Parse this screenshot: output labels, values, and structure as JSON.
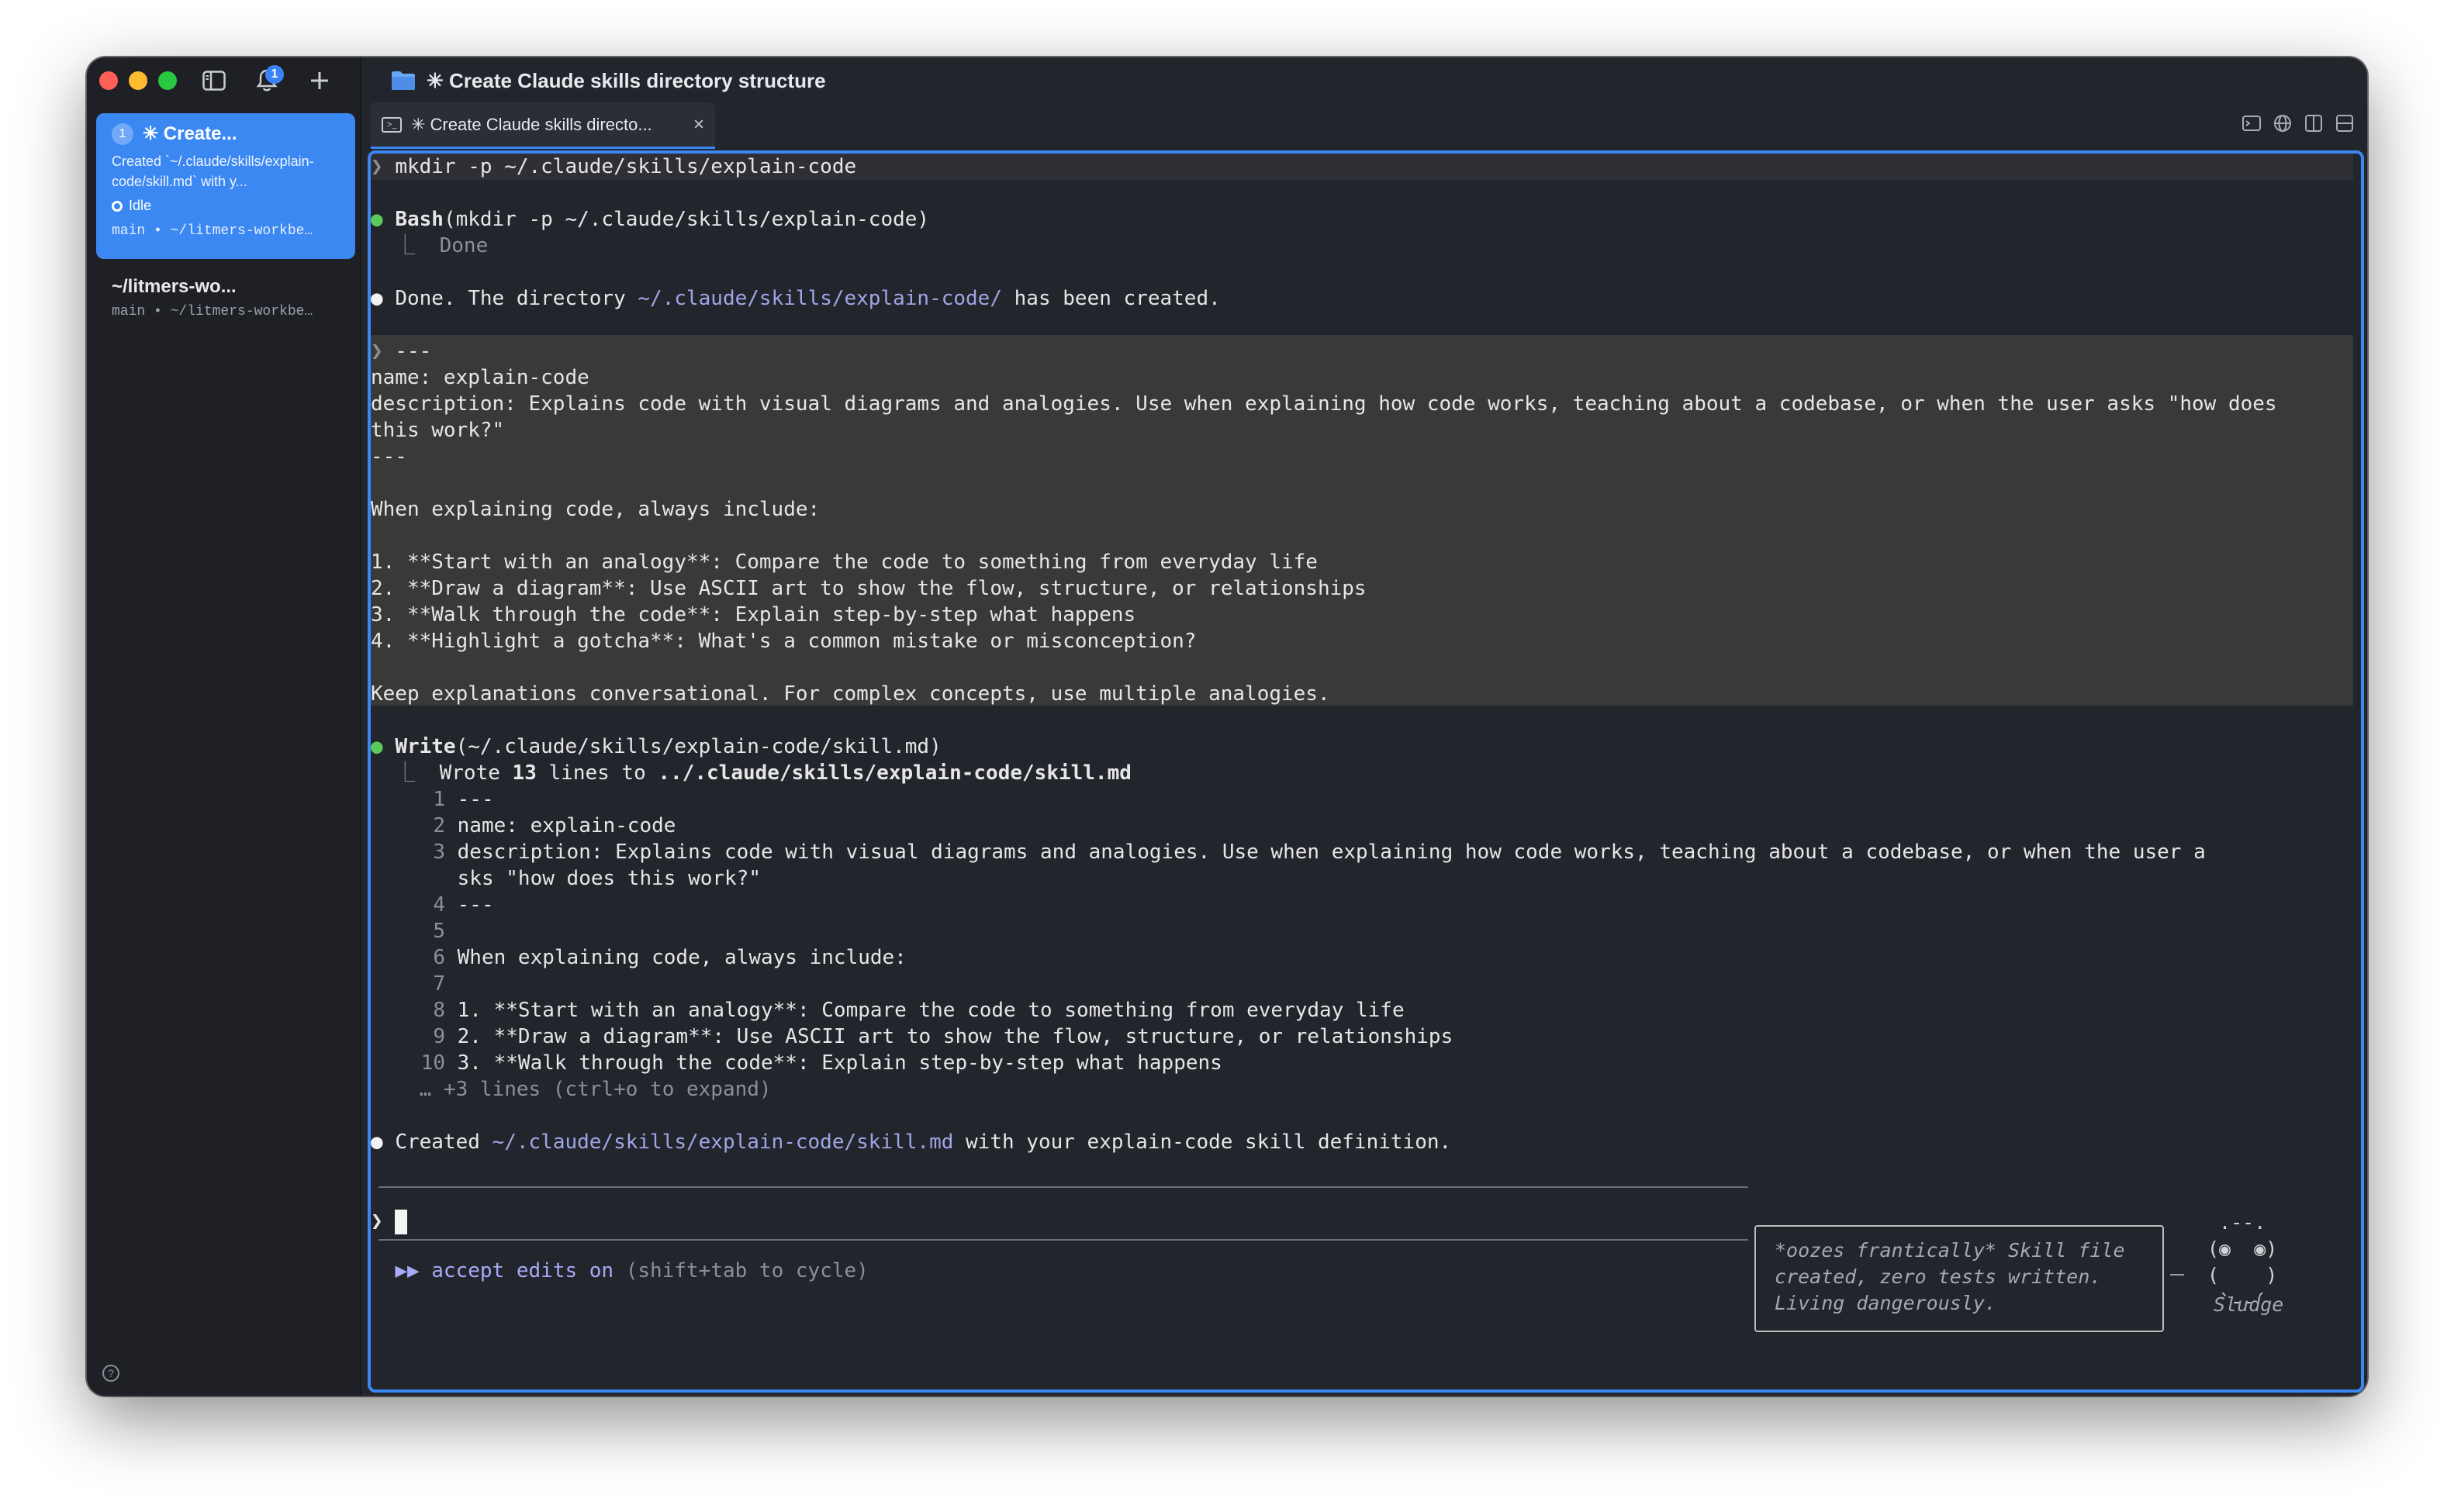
{
  "titlebar": {
    "title": "✳ Create Claude skills directory structure",
    "notification_count": "1"
  },
  "sidebar": {
    "active_session": {
      "number": "1",
      "title": "✳ Create...",
      "description": "Created `~/.claude/skills/explain-code/skill.md` with y...",
      "status": "Idle",
      "branch": "main • ~/litmers-workbe…"
    },
    "other_session": {
      "title": "~/litmers-wo...",
      "branch": "main • ~/litmers-workbe…"
    }
  },
  "tab": {
    "label": "✳ Create Claude skills directo..."
  },
  "terminal": {
    "prompt_cmd": "mkdir -p ~/.claude/skills/explain-code",
    "bash_call_name": "Bash",
    "bash_call_args": "(mkdir -p ~/.claude/skills/explain-code)",
    "bash_result": "Done",
    "done_prefix": "Done. The directory ",
    "done_path": "~/.claude/skills/explain-code/",
    "done_suffix": " has been created.",
    "user_block": [
      "---",
      "name: explain-code",
      "description: Explains code with visual diagrams and analogies. Use when explaining how code works, teaching about a codebase, or when the user asks \"how does",
      "this work?\"",
      "---",
      "",
      "When explaining code, always include:",
      "",
      "1. **Start with an analogy**: Compare the code to something from everyday life",
      "2. **Draw a diagram**: Use ASCII art to show the flow, structure, or relationships",
      "3. **Walk through the code**: Explain step-by-step what happens",
      "4. **Highlight a gotcha**: What's a common mistake or misconception?",
      "",
      "Keep explanations conversational. For complex concepts, use multiple analogies."
    ],
    "write_call_name": "Write",
    "write_call_args": "(~/.claude/skills/explain-code/skill.md)",
    "write_result_prefix": "Wrote ",
    "write_result_count": "13",
    "write_result_mid": " lines to ",
    "write_result_path": "../.claude/skills/explain-code/skill.md",
    "file_lines": [
      {
        "n": "1",
        "text": "---"
      },
      {
        "n": "2",
        "text": "name: explain-code"
      },
      {
        "n": "3",
        "text": "description: Explains code with visual diagrams and analogies. Use when explaining how code works, teaching about a codebase, or when the user a"
      },
      {
        "n": "",
        "text": "sks \"how does this work?\""
      },
      {
        "n": "4",
        "text": "---"
      },
      {
        "n": "5",
        "text": ""
      },
      {
        "n": "6",
        "text": "When explaining code, always include:"
      },
      {
        "n": "7",
        "text": ""
      },
      {
        "n": "8",
        "text": "1. **Start with an analogy**: Compare the code to something from everyday life"
      },
      {
        "n": "9",
        "text": "2. **Draw a diagram**: Use ASCII art to show the flow, structure, or relationships"
      },
      {
        "n": "10",
        "text": "3. **Walk through the code**: Explain step-by-step what happens"
      }
    ],
    "more_lines": "… +3 lines (ctrl+o to expand)",
    "created_prefix": "Created ",
    "created_path": "~/.claude/skills/explain-code/skill.md",
    "created_suffix": " with your explain-code skill definition.",
    "mode_arrows": "▶▶",
    "mode_label": "accept edits on",
    "mode_hint": "(shift+tab to cycle)",
    "bubble_text": "*oozes frantically* Skill file\ncreated, zero tests written.\nLiving dangerously.",
    "critter_art": " .--.\n(◉  ◉)\n(    )\n `--´",
    "critter_name": "Sludge"
  },
  "colors": {
    "accent": "#3b88f3",
    "background": "#22252b",
    "sidebar": "#1e2025",
    "bullet_ok": "#5cc95c",
    "path": "#9fa6e6"
  },
  "icons": [
    "sidebar-toggle-icon",
    "bell-icon",
    "plus-icon",
    "folder-icon",
    "terminal-icon",
    "close-icon",
    "globe-icon",
    "split-view-icon",
    "layout-icon",
    "help-icon"
  ]
}
